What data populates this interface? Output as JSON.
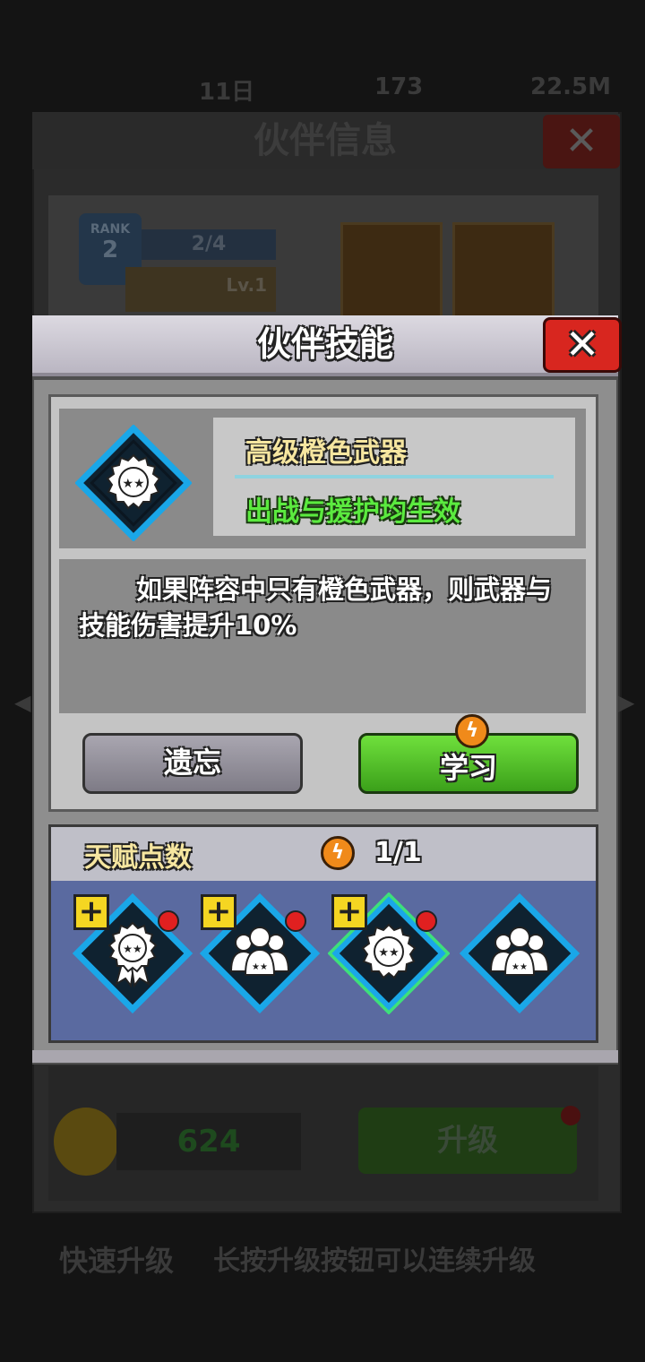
{
  "background": {
    "top_stats": [
      "11日",
      "173",
      "22.5M"
    ],
    "panel_title": "伙伴信息",
    "close_glyph": "✕",
    "rank_label": "RANK",
    "rank_value": "2",
    "progress_text": "2/4",
    "level_text": "Lv.1",
    "coin_value": "624",
    "upgrade_label": "升级",
    "tip_title": "快速升级",
    "tip_text": "长按升级按钮可以连续升级"
  },
  "modal": {
    "title": "伙伴技能",
    "close_glyph": "✕",
    "skill": {
      "name": "高级橙色武器",
      "effect": "出战与援护均生效",
      "description": "如果阵容中只有橙色武器，则武器与技能伤害提升10%"
    },
    "buttons": {
      "forget": "遗忘",
      "learn": "学习"
    },
    "talent": {
      "label": "天赋点数",
      "count": "1/1"
    },
    "talent_slots": [
      {
        "icon": "medal-ribbon-icon",
        "has_plus": true,
        "has_dot": true,
        "selected": false
      },
      {
        "icon": "group-icon",
        "has_plus": true,
        "has_dot": true,
        "selected": false
      },
      {
        "icon": "medal-icon",
        "has_plus": true,
        "has_dot": true,
        "selected": true
      },
      {
        "icon": "group-icon",
        "has_plus": false,
        "has_dot": false,
        "selected": false
      }
    ],
    "plus_glyph": "+",
    "bolt_glyph": "ϟ"
  },
  "colors": {
    "accent_blue": "#1aa7e8",
    "selected_green": "#3ee07a",
    "close_red": "#d8261f",
    "learn_green": "#4cc425"
  }
}
